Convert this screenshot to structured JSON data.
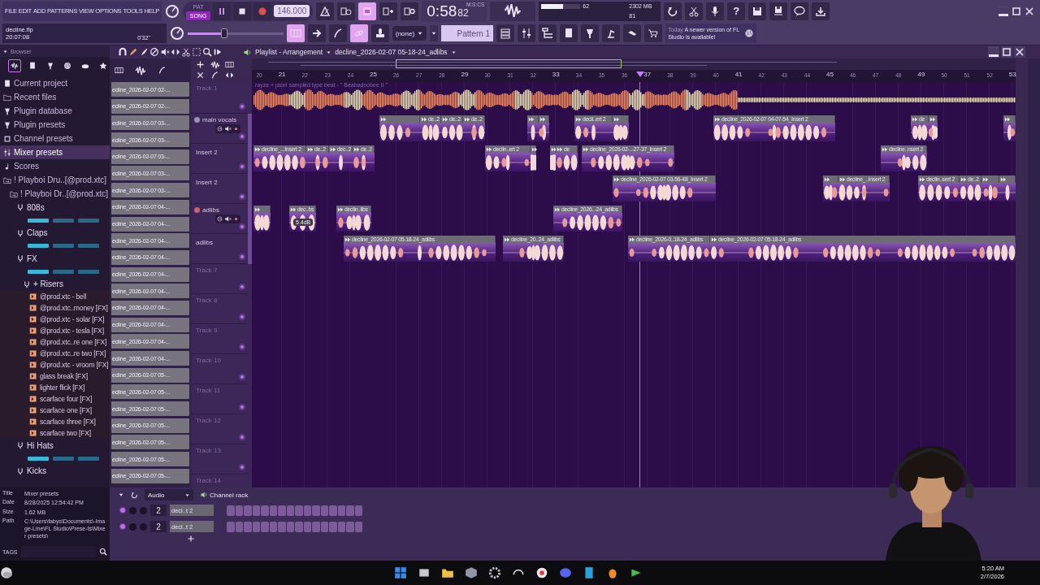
{
  "menu": [
    "FILE",
    "EDIT",
    "ADD",
    "PATTERNS",
    "VIEW",
    "OPTIONS",
    "TOOLS",
    "HELP"
  ],
  "project": {
    "file": "decline.flp",
    "clock": "20:07:08",
    "elapsed": "0'32''"
  },
  "transport": {
    "modes": [
      {
        "label": "PAT",
        "selected": false
      },
      {
        "label": "SONG",
        "selected": true
      }
    ],
    "tempo": "146.000"
  },
  "time": {
    "value": "0:58",
    "centis": "82",
    "unit": "M:S:CS"
  },
  "meters": {
    "cpu": {
      "reading": "62",
      "level": 0.55
    },
    "memory": "2302 MB",
    "polyphony": "81"
  },
  "master_volume": {
    "level": 0.38
  },
  "help_glyph": "?",
  "pattern": {
    "filter": "(none)",
    "name": "Pattern 1"
  },
  "news": {
    "tag": "Today",
    "message": "A newer version of FL Studio is available!"
  },
  "browser": {
    "title": "Browser",
    "tabs": [
      {
        "selected": true
      },
      {
        "selected": false
      },
      {
        "selected": false
      },
      {
        "selected": false
      },
      {
        "selected": false
      },
      {
        "selected": false
      }
    ],
    "tree": [
      {
        "label": "Current project",
        "kind": "project",
        "selected": false
      },
      {
        "label": "Recent files",
        "kind": "recent",
        "selected": false
      },
      {
        "label": "Plugin database",
        "kind": "plugin",
        "selected": false
      },
      {
        "label": "Plugin presets",
        "kind": "plugin",
        "selected": false
      },
      {
        "label": "Channel presets",
        "kind": "channel",
        "selected": false
      },
      {
        "label": "Mixer presets",
        "kind": "mixer",
        "selected": true
      },
      {
        "label": "Scores",
        "kind": "score",
        "selected": false
      },
      {
        "label": "! Playboi Dru..[@prod.xtc]",
        "kind": "folder",
        "selected": false,
        "children": [
          {
            "label": "! Playboi Dr..[@prod.xtc]",
            "kind": "folder",
            "selected": false,
            "children": [
              {
                "label": "808s",
                "kind": "pack",
                "selected": false,
                "children": [
                  {
                    "kind": "thumbnails"
                  }
                ]
              },
              {
                "label": "Claps",
                "kind": "pack",
                "selected": false,
                "children": [
                  {
                    "kind": "thumbnails"
                  }
                ]
              },
              {
                "label": "FX",
                "kind": "pack",
                "selected": false,
                "children": [
                  {
                    "kind": "thumbnails"
                  },
                  {
                    "label": "+ Risers",
                    "kind": "pack",
                    "selected": false,
                    "children": [
                      {
                        "label": "@prod.xtc - bell",
                        "kind": "audio",
                        "selected": false
                      },
                      {
                        "label": "@prod.xtc..money [FX]",
                        "kind": "audio",
                        "selected": false
                      },
                      {
                        "label": "@prod.xtc - solar [FX]",
                        "kind": "audio",
                        "selected": false
                      },
                      {
                        "label": "@prod.xtc - tesla [FX]",
                        "kind": "audio",
                        "selected": false
                      },
                      {
                        "label": "@prod.xtc..re one [FX]",
                        "kind": "audio",
                        "selected": false
                      },
                      {
                        "label": "@prod.xtc..re two [FX]",
                        "kind": "audio",
                        "selected": false
                      },
                      {
                        "label": "@prod.xtc - vroom [FX]",
                        "kind": "audio",
                        "selected": false
                      },
                      {
                        "label": "glass break [FX]",
                        "kind": "audio",
                        "selected": false
                      },
                      {
                        "label": "lighter flick [FX]",
                        "kind": "audio",
                        "selected": false
                      },
                      {
                        "label": "scarface four [FX]",
                        "kind": "audio",
                        "selected": false
                      },
                      {
                        "label": "scarface one [FX]",
                        "kind": "audio",
                        "selected": false
                      },
                      {
                        "label": "scarface three [FX]",
                        "kind": "audio",
                        "selected": false
                      },
                      {
                        "label": "scarface two [FX]",
                        "kind": "audio",
                        "selected": false
                      }
                    ]
                  }
                ]
              },
              {
                "label": "Hi Hats",
                "kind": "pack",
                "selected": false,
                "children": [
                  {
                    "kind": "thumbnails"
                  }
                ]
              },
              {
                "label": "Kicks",
                "kind": "pack",
                "selected": false
              }
            ]
          }
        ]
      }
    ],
    "info": [
      {
        "label": "Title",
        "value": "Mixer presets"
      },
      {
        "label": "Date",
        "value": "8/28/2025 12:54:42 PM"
      },
      {
        "label": "Size",
        "value": "1.62 MB"
      },
      {
        "label": "Path",
        "value": "C:\\Users\\fabys\\Documents\\-Image-Line\\FL Studio\\Prese-ts\\Mixer presets\\"
      }
    ],
    "tags_label": "TAGS"
  },
  "playlist": {
    "title": "Playlist - Arrangement",
    "clip_name": "decline_2026-02-07 05-18-24_adlibs",
    "picker": [
      "ecline_2026-02-07 02-...",
      "ecline_2026-02-07 02-...",
      "ecline_2026-02-07 03-...",
      "ecline_2026-02-07 03-...",
      "ecline_2026-02-07 03-...",
      "ecline_2026-02-07 03-...",
      "ecline_2026-02-07 03-...",
      "ecline_2026-02-07 04-...",
      "ecline_2026-02-07 04-...",
      "ecline_2026-02-07 04-...",
      "ecline_2026-02-07 04-...",
      "ecline_2026-02-07 04-...",
      "ecline_2026-02-07 04-...",
      "ecline_2026-02-07 04-...",
      "ecline_2026-02-07 04-...",
      "ecline_2026-02-07 04-...",
      "ecline_2026-02-07 04-...",
      "ecline_2026-02-07 05-...",
      "ecline_2026-02-07 05-...",
      "ecline_2026-02-07 05-...",
      "ecline_2026-02-07 05-...",
      "ecline_2026-02-07 05-...",
      "ecline_2026-02-07 05-...",
      "ecline_2026-02-07 05-..."
    ],
    "ruler": [
      "20",
      "21",
      "22",
      "23",
      "24",
      "25",
      "26",
      "27",
      "28",
      "29",
      "30",
      "31",
      "32",
      "33",
      "34",
      "35",
      "36",
      "37",
      "38",
      "39",
      "40",
      "41",
      "42",
      "43",
      "44",
      "45",
      "46",
      "47",
      "48",
      "49",
      "50",
      "51",
      "52",
      "53"
    ],
    "tracks": [
      {
        "name": "Track 1",
        "kind": "plain",
        "enabled": true,
        "clips": [
          {
            "kind": "beat",
            "label": "rayze + jacel sampled type beat - \" Beabadoobee II \""
          }
        ]
      },
      {
        "name": "main vocals",
        "kind": "folder",
        "enabled": true,
        "color": "#9c90b4",
        "clips": [
          {
            "kind": "vocal"
          },
          {
            "kind": "vocal",
            "label": "de..2"
          },
          {
            "kind": "vocal",
            "label": "de..2"
          },
          {
            "kind": "vocal",
            "label": "de..2"
          },
          {
            "kind": "vocal"
          },
          {
            "kind": "vocal"
          },
          {
            "kind": "vocal",
            "label": "decli..ert 2"
          },
          {
            "kind": "vocal"
          },
          {
            "kind": "vocal",
            "label": "decline_2026-02-07 04-07-54_Insert 2"
          },
          {
            "kind": "vocal",
            "label": "de"
          },
          {
            "kind": "vocal"
          },
          {
            "kind": "vocal"
          }
        ]
      },
      {
        "name": "Insert 2",
        "kind": "named",
        "enabled": true,
        "clips": [
          {
            "kind": "vocal",
            "label": "decline_...Insert 2"
          },
          {
            "kind": "vocal",
            "label": "de..2"
          },
          {
            "kind": "vocal",
            "label": "dec..2"
          },
          {
            "kind": "vocal",
            "label": "de..2"
          },
          {
            "kind": "vocal",
            "label": "declin..ert 2"
          },
          {
            "kind": "vocal"
          },
          {
            "kind": "vocal"
          },
          {
            "kind": "vocal",
            "label": "de"
          },
          {
            "kind": "vocal",
            "label": "decline_2026-02-..-27-37_Insert 2"
          },
          {
            "kind": "vocal",
            "label": "decline..nsert 2"
          }
        ]
      },
      {
        "name": "Insert 2",
        "kind": "named",
        "enabled": true,
        "clips": [
          {
            "kind": "vocal",
            "label": "decline_2026-02-07 03-56-48_Insert 2"
          },
          {
            "kind": "vocal"
          },
          {
            "kind": "vocal",
            "label": "decline_..Insert 2"
          },
          {
            "kind": "vocal",
            "label": "declin..sert 2"
          },
          {
            "kind": "vocal",
            "label": "de..2"
          },
          {
            "kind": "vocal"
          },
          {
            "kind": "vocal"
          }
        ]
      },
      {
        "name": "adlibs",
        "kind": "folder",
        "enabled": true,
        "color": "#d4606e",
        "clips": [
          {
            "kind": "vocal"
          },
          {
            "kind": "vocal",
            "label": "dec..bs",
            "tooltip": "5.4dB"
          },
          {
            "kind": "vocal",
            "label": "declin..libs"
          },
          {
            "kind": "vocal",
            "label": "decline_2026..-24_adlibs"
          }
        ]
      },
      {
        "name": "adlibs",
        "kind": "named",
        "enabled": true,
        "clips": [
          {
            "kind": "vocal",
            "label": "decline_2026-02-07 05-18-24_adlibs"
          },
          {
            "kind": "vocal",
            "label": "decline_20..24_adlibs"
          },
          {
            "kind": "vocal",
            "label": "decline_2026-0..18-24_adlibs"
          },
          {
            "kind": "vocal",
            "label": "decline_2026-02-07 05-18-24_adlibs"
          }
        ]
      },
      {
        "name": "Track 7",
        "kind": "plain",
        "enabled": true
      },
      {
        "name": "Track 8",
        "kind": "plain",
        "enabled": true
      },
      {
        "name": "Track 9",
        "kind": "plain",
        "enabled": true
      },
      {
        "name": "Track 10",
        "kind": "plain",
        "enabled": true
      },
      {
        "name": "Track 11",
        "kind": "plain",
        "enabled": true
      },
      {
        "name": "Track 12",
        "kind": "plain",
        "enabled": true
      },
      {
        "name": "Track 13",
        "kind": "plain",
        "enabled": true
      },
      {
        "name": "Track 14",
        "kind": "plain"
      }
    ]
  },
  "channel_rack": {
    "group": "Audio",
    "title": "Channel rack",
    "channels": [
      {
        "number": "2",
        "name": "decl..t 2",
        "on": true
      },
      {
        "number": "2",
        "name": "decl..t 2",
        "on": true
      }
    ]
  },
  "taskbar": {
    "time": "5:20 AM",
    "date": "2/7/2026"
  }
}
